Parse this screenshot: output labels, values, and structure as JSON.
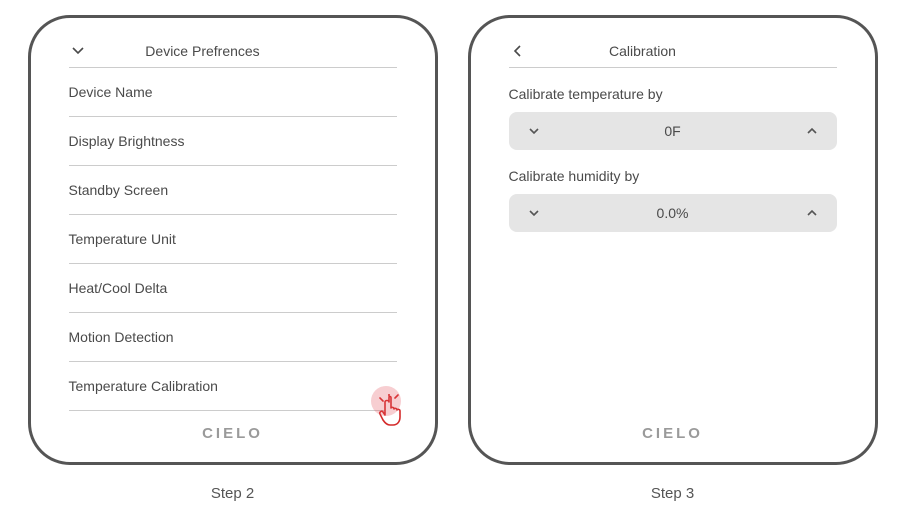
{
  "step2": {
    "header": "Device Prefrences",
    "items": [
      "Device Name",
      "Display Brightness",
      "Standby Screen",
      "Temperature Unit",
      "Heat/Cool Delta",
      "Motion Detection",
      "Temperature Calibration"
    ],
    "brand": "CIELO",
    "caption": "Step 2"
  },
  "step3": {
    "header": "Calibration",
    "temp": {
      "label": "Calibrate temperature by",
      "value": "0F"
    },
    "humidity": {
      "label": "Calibrate humidity by",
      "value": "0.0%"
    },
    "brand": "CIELO",
    "caption": "Step 3"
  }
}
